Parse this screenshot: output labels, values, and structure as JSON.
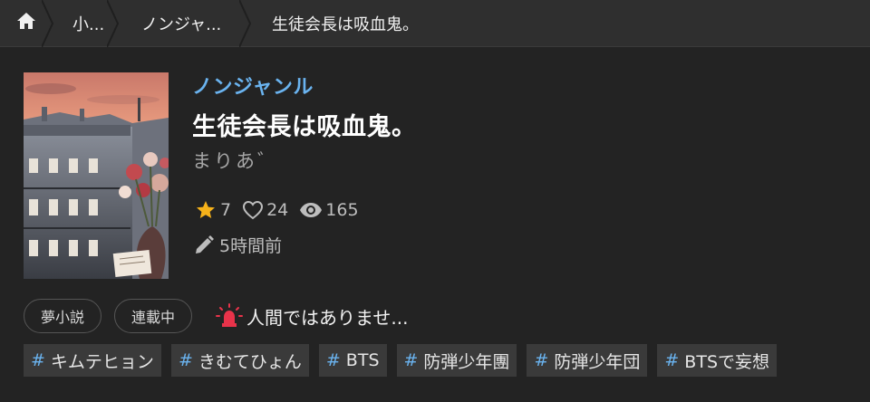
{
  "breadcrumb": {
    "home_icon": "home-icon",
    "items": [
      "小...",
      "ノンジャ...",
      "生徒会長は吸血鬼。"
    ]
  },
  "novel": {
    "genre": "ノンジャンル",
    "title": "生徒会長は吸血鬼。",
    "author": "まりあ゛",
    "stars": "7",
    "likes": "24",
    "views": "165",
    "updated": "5時間前"
  },
  "status_pills": [
    "夢小説",
    "連載中"
  ],
  "warning": {
    "icon": "alert-light-icon",
    "text": "人間ではありませ..."
  },
  "tags": [
    "キムテヒョン",
    "きむてひょん",
    "BTS",
    "防弾少年團",
    "防弾少年団",
    "BTSで妄想"
  ],
  "colors": {
    "accent": "#6ab3ef",
    "star": "#f6b21a",
    "warning": "#e8334a",
    "background": "#232323"
  }
}
